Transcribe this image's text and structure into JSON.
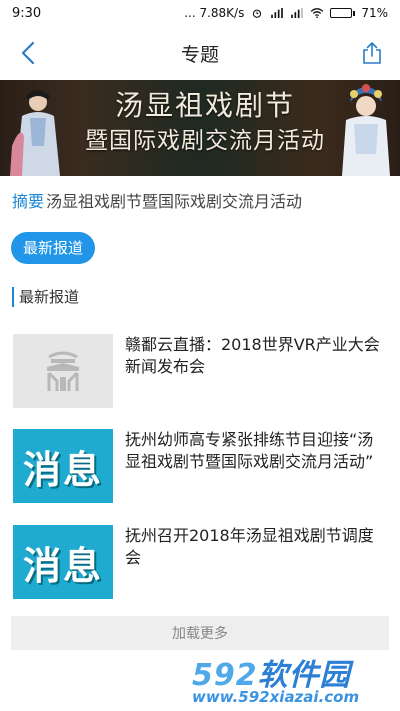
{
  "status_bar": {
    "time": "9:30",
    "network_speed": "... 7.88K/s",
    "battery_percent": "71%",
    "battery_level": 0.71
  },
  "nav": {
    "title": "专题",
    "back_icon": "chevron-left-icon",
    "share_icon": "share-icon"
  },
  "banner": {
    "line1": "汤显祖戏剧节",
    "line2": "暨国际戏剧交流月活动"
  },
  "summary": {
    "label": "摘要",
    "text": "汤显祖戏剧节暨国际戏剧交流月活动"
  },
  "tabs": [
    {
      "label": "最新报道",
      "active": true
    }
  ],
  "section": {
    "title": "最新报道"
  },
  "articles": [
    {
      "title": "赣鄱云直播：2018世界VR产业大会新闻发布会",
      "thumbnail": "placeholder-logo"
    },
    {
      "title": "抚州幼师高专紧张排练节目迎接“汤显祖戏剧节暨国际戏剧交流月活动”",
      "thumbnail": "news",
      "thumb_text": "消息"
    },
    {
      "title": "抚州召开2018年汤显祖戏剧节调度会",
      "thumbnail": "news",
      "thumb_text": "消息"
    }
  ],
  "load_more": {
    "label": "加载更多"
  },
  "watermark": {
    "brand_num": "592",
    "brand_cn": "软件园",
    "url": "www.592xiazai.com"
  },
  "colors": {
    "accent": "#2196e8",
    "summary_label": "#1e88d6",
    "news_thumb": "#1faad0"
  }
}
